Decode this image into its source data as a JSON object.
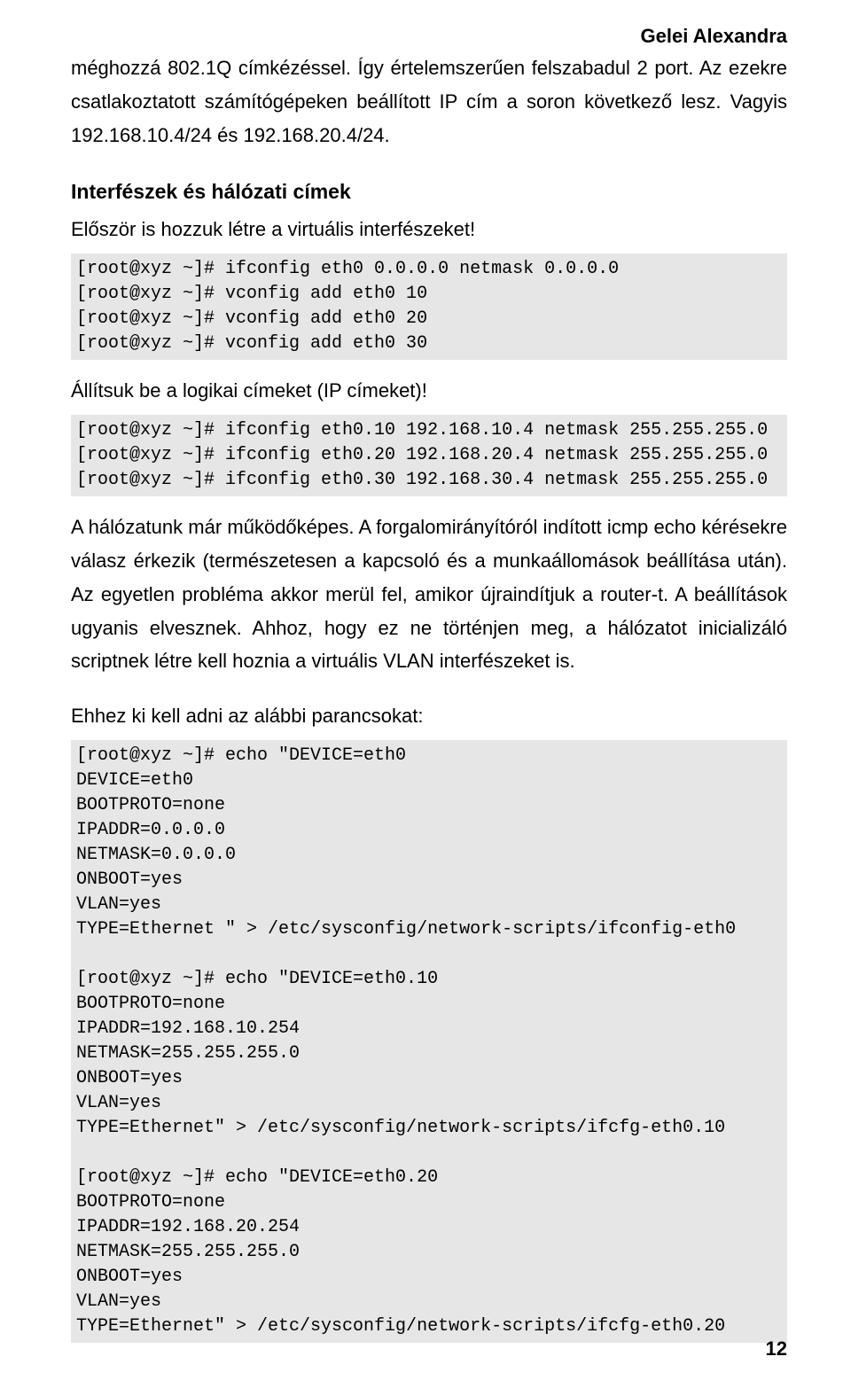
{
  "header": {
    "author": "Gelei Alexandra"
  },
  "paragraphs": {
    "p1": "méghozzá 802.1Q címkézéssel. Így értelemszerűen felszabadul 2 port. Az ezekre csatlakoztatott számítógépeken beállított IP cím a soron következő lesz. Vagyis 192.168.10.4/24 és 192.168.20.4/24.",
    "section1_title": "Interfészek és hálózati címek",
    "section1_intro": "Először is hozzuk létre a virtuális interfészeket!",
    "code1": "[root@xyz ~]# ifconfig eth0 0.0.0.0 netmask 0.0.0.0\n[root@xyz ~]# vconfig add eth0 10\n[root@xyz ~]# vconfig add eth0 20\n[root@xyz ~]# vconfig add eth0 30",
    "p2": "Állítsuk be a logikai címeket (IP címeket)!",
    "code2": "[root@xyz ~]# ifconfig eth0.10 192.168.10.4 netmask 255.255.255.0\n[root@xyz ~]# ifconfig eth0.20 192.168.20.4 netmask 255.255.255.0\n[root@xyz ~]# ifconfig eth0.30 192.168.30.4 netmask 255.255.255.0",
    "p3": "A hálózatunk már működőképes. A forgalomirányítóról indított icmp echo kérésekre válasz érkezik (természetesen a kapcsoló és a munkaállomások beállítása után). Az egyetlen probléma akkor merül fel, amikor újraindítjuk a router-t. A beállítások ugyanis elvesznek. Ahhoz, hogy ez ne történjen meg, a hálózatot inicializáló scriptnek létre kell hoznia a virtuális VLAN interfészeket is.",
    "p4": "Ehhez ki kell adni az alábbi parancsokat:",
    "code3": "[root@xyz ~]# echo \"DEVICE=eth0\nDEVICE=eth0\nBOOTPROTO=none\nIPADDR=0.0.0.0\nNETMASK=0.0.0.0\nONBOOT=yes\nVLAN=yes\nTYPE=Ethernet \" > /etc/sysconfig/network-scripts/ifconfig-eth0\n\n[root@xyz ~]# echo \"DEVICE=eth0.10\nBOOTPROTO=none\nIPADDR=192.168.10.254\nNETMASK=255.255.255.0\nONBOOT=yes\nVLAN=yes\nTYPE=Ethernet\" > /etc/sysconfig/network-scripts/ifcfg-eth0.10\n\n[root@xyz ~]# echo \"DEVICE=eth0.20\nBOOTPROTO=none\nIPADDR=192.168.20.254\nNETMASK=255.255.255.0\nONBOOT=yes\nVLAN=yes\nTYPE=Ethernet\" > /etc/sysconfig/network-scripts/ifcfg-eth0.20"
  },
  "footer": {
    "page_number": "12"
  }
}
